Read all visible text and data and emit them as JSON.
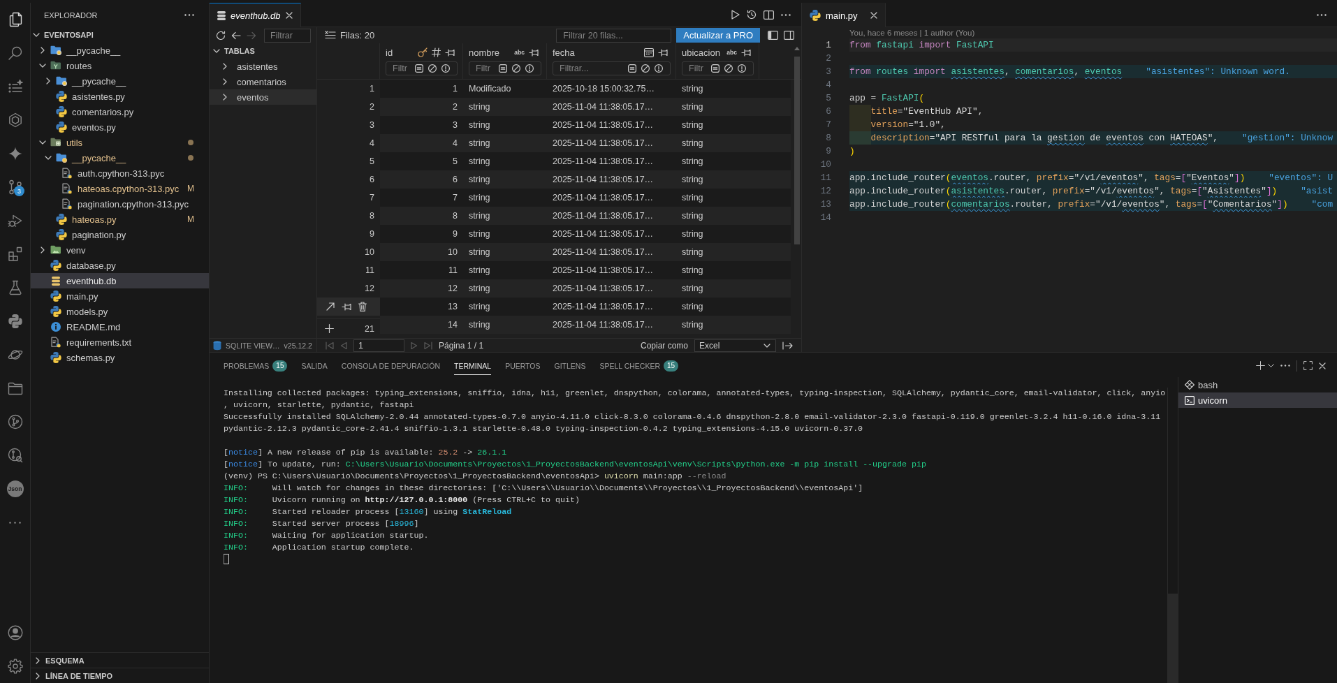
{
  "activity_bar": {
    "items": [
      {
        "kind": "explorer",
        "selected": true
      },
      {
        "kind": "search",
        "selected": false
      },
      {
        "kind": "tasks",
        "selected": false
      },
      {
        "kind": "hexagon",
        "selected": false
      },
      {
        "kind": "sparkle",
        "selected": false
      },
      {
        "kind": "source_control",
        "selected": false,
        "badge": "3"
      },
      {
        "kind": "debug",
        "selected": false
      },
      {
        "kind": "extensions",
        "selected": false
      },
      {
        "kind": "testing",
        "selected": false
      },
      {
        "kind": "python",
        "selected": false
      },
      {
        "kind": "orbit",
        "selected": false
      },
      {
        "kind": "projects",
        "selected": false
      },
      {
        "kind": "git_graph",
        "selected": false
      },
      {
        "kind": "git_inspect",
        "selected": false
      },
      {
        "kind": "json",
        "label": "Json",
        "selected": false
      },
      {
        "kind": "more",
        "selected": false
      }
    ],
    "bottom_items": [
      {
        "kind": "account",
        "selected": false
      },
      {
        "kind": "settings",
        "selected": false
      }
    ]
  },
  "explorer": {
    "title": "EXPLORADOR",
    "root": {
      "label": "EVENTOSAPI",
      "expanded": true
    },
    "tree": [
      {
        "label": "__pycache__",
        "kind": "cachefolder",
        "expanded": false,
        "modified": false,
        "selected": false
      },
      {
        "label": "routes",
        "kind": "routesfolder",
        "expanded": true,
        "modified": false,
        "selected": false,
        "children": [
          {
            "label": "__pycache__",
            "kind": "cachefolder",
            "expanded": false,
            "modified": false,
            "selected": false
          },
          {
            "label": "asistentes.py",
            "kind": "python",
            "modified": false,
            "selected": false
          },
          {
            "label": "comentarios.py",
            "kind": "python",
            "modified": false,
            "selected": false
          },
          {
            "label": "eventos.py",
            "kind": "python",
            "modified": false,
            "selected": false
          }
        ]
      },
      {
        "label": "utils",
        "kind": "utilsfolder",
        "expanded": true,
        "modified": true,
        "selected": false,
        "children": [
          {
            "label": "__pycache__",
            "kind": "cachefolder",
            "expanded": true,
            "modified": true,
            "selected": false,
            "children": [
              {
                "label": "auth.cpython-313.pyc",
                "kind": "bytecode",
                "modified": false,
                "selected": false
              },
              {
                "label": "hateoas.cpython-313.pyc",
                "kind": "bytecode",
                "modified": true,
                "decoration": "M",
                "selected": false
              },
              {
                "label": "pagination.cpython-313.pyc",
                "kind": "bytecode",
                "modified": false,
                "selected": false
              }
            ]
          },
          {
            "label": "hateoas.py",
            "kind": "python",
            "modified": true,
            "decoration": "M",
            "selected": false
          },
          {
            "label": "pagination.py",
            "kind": "python",
            "modified": false,
            "selected": false
          }
        ]
      },
      {
        "label": "venv",
        "kind": "envfolder",
        "expanded": false,
        "modified": false,
        "selected": false
      },
      {
        "label": "database.py",
        "kind": "python",
        "modified": false,
        "selected": false
      },
      {
        "label": "eventhub.db",
        "kind": "database",
        "modified": false,
        "selected": true
      },
      {
        "label": "main.py",
        "kind": "python",
        "modified": false,
        "selected": false
      },
      {
        "label": "models.py",
        "kind": "python",
        "modified": false,
        "selected": false
      },
      {
        "label": "README.md",
        "kind": "readme",
        "modified": false,
        "selected": false
      },
      {
        "label": "requirements.txt",
        "kind": "text",
        "modified": false,
        "selected": false
      },
      {
        "label": "schemas.py",
        "kind": "python",
        "modified": false,
        "selected": false
      }
    ],
    "sections": [
      {
        "label": "ESQUEMA",
        "expanded": false
      },
      {
        "label": "LÍNEA DE TIEMPO",
        "expanded": false
      }
    ]
  },
  "sqlite_editor": {
    "focused": true,
    "tab": {
      "label": "eventhub.db",
      "selected": true,
      "preview": true
    },
    "toolbar": {
      "navigation": [
        {
          "kind": "back",
          "disabled": false
        },
        {
          "kind": "forward",
          "disabled": true
        }
      ],
      "filter": {
        "placeholder": "Filtrar"
      },
      "row_count": "Filas: 20",
      "rows_filter": {
        "placeholder": "Filtrar 20 filas..."
      },
      "upgrade_button": "Actualizar a PRO"
    },
    "tables": {
      "title": "TABLAS",
      "expanded": true,
      "items": [
        {
          "label": "asistentes",
          "expanded": false,
          "selected": false
        },
        {
          "label": "comentarios",
          "expanded": false,
          "selected": false
        },
        {
          "label": "eventos",
          "expanded": false,
          "selected": true
        }
      ]
    },
    "grid": {
      "columns": [
        {
          "name": "id",
          "kind": "integer",
          "primary_key": true,
          "filter": {
            "placeholder": "Filtr"
          }
        },
        {
          "name": "nombre",
          "kind": "text",
          "type_label": "abc",
          "primary_key": false,
          "filter": {
            "placeholder": "Filtr"
          }
        },
        {
          "name": "fecha",
          "kind": "datetime",
          "primary_key": false,
          "filter": {
            "placeholder": "Filtrar..."
          }
        },
        {
          "name": "ubicacion",
          "kind": "text",
          "type_label": "abc",
          "primary_key": false,
          "filter": {
            "placeholder": "Filtr"
          }
        }
      ],
      "rows": [
        {
          "number": "1",
          "hovered": false,
          "cells": [
            "1",
            "Modificado",
            "2025-10-18 15:00:32.75…",
            "string"
          ]
        },
        {
          "number": "2",
          "hovered": false,
          "cells": [
            "2",
            "string",
            "2025-11-04 11:38:05.17…",
            "string"
          ]
        },
        {
          "number": "3",
          "hovered": false,
          "cells": [
            "3",
            "string",
            "2025-11-04 11:38:05.17…",
            "string"
          ]
        },
        {
          "number": "4",
          "hovered": false,
          "cells": [
            "4",
            "string",
            "2025-11-04 11:38:05.17…",
            "string"
          ]
        },
        {
          "number": "5",
          "hovered": false,
          "cells": [
            "5",
            "string",
            "2025-11-04 11:38:05.17…",
            "string"
          ]
        },
        {
          "number": "6",
          "hovered": false,
          "cells": [
            "6",
            "string",
            "2025-11-04 11:38:05.17…",
            "string"
          ]
        },
        {
          "number": "7",
          "hovered": false,
          "cells": [
            "7",
            "string",
            "2025-11-04 11:38:05.17…",
            "string"
          ]
        },
        {
          "number": "8",
          "hovered": false,
          "cells": [
            "8",
            "string",
            "2025-11-04 11:38:05.17…",
            "string"
          ]
        },
        {
          "number": "9",
          "hovered": false,
          "cells": [
            "9",
            "string",
            "2025-11-04 11:38:05.17…",
            "string"
          ]
        },
        {
          "number": "10",
          "hovered": false,
          "cells": [
            "10",
            "string",
            "2025-11-04 11:38:05.17…",
            "string"
          ]
        },
        {
          "number": "11",
          "hovered": false,
          "cells": [
            "11",
            "string",
            "2025-11-04 11:38:05.17…",
            "string"
          ]
        },
        {
          "number": "12",
          "hovered": false,
          "cells": [
            "12",
            "string",
            "2025-11-04 11:38:05.17…",
            "string"
          ]
        },
        {
          "hovered": true,
          "cells": [
            "13",
            "string",
            "2025-11-04 11:38:05.17…",
            "string"
          ]
        },
        {
          "hovered": false,
          "cells": [
            "14",
            "string",
            "2025-11-04 11:38:05.17…",
            "string"
          ]
        }
      ],
      "new_row_number": "21"
    },
    "footer": {
      "extension_name": "SQLITE VIEW…",
      "version": "v25.12.2",
      "pager": [
        {
          "kind": "first",
          "disabled": true
        },
        {
          "kind": "previous",
          "disabled": true
        },
        {
          "kind": "next",
          "disabled": true
        },
        {
          "kind": "last",
          "disabled": true
        }
      ],
      "page": {
        "value": "1"
      },
      "page_label": "Página 1 / 1",
      "copy_label": "Copiar como",
      "copy_format": {
        "value": "Excel"
      }
    }
  },
  "code_editor": {
    "focused": false,
    "tab": {
      "label": "main.py",
      "selected": true,
      "preview": false
    },
    "blame": "You, hace 6 meses | 1 author (You)",
    "lines": [
      {
        "number": "1",
        "current": true,
        "tokens": [
          {
            "text": "from ",
            "kind": "keyword"
          },
          {
            "text": "fastapi ",
            "kind": "module"
          },
          {
            "text": "import ",
            "kind": "keyword"
          },
          {
            "text": "FastAPI",
            "kind": "class"
          }
        ]
      },
      {
        "number": "2",
        "current": false
      },
      {
        "number": "3",
        "current": false,
        "tokens": [
          {
            "text": "from ",
            "kind": "keyword"
          },
          {
            "text": "routes ",
            "kind": "module"
          },
          {
            "text": "import ",
            "kind": "keyword"
          },
          {
            "text": "asistentes",
            "kind": "module",
            "squiggle": true
          },
          {
            "text": ", ",
            "kind": "plain"
          },
          {
            "text": "comentarios",
            "kind": "module",
            "squiggle": true
          },
          {
            "text": ", ",
            "kind": "plain"
          },
          {
            "text": "eventos",
            "kind": "module",
            "squiggle": true
          }
        ],
        "diagnostic": "\"asistentes\": Unknown word."
      },
      {
        "number": "4",
        "current": false
      },
      {
        "number": "5",
        "current": false,
        "tokens": [
          {
            "text": "app = ",
            "kind": "plain"
          },
          {
            "text": "FastAPI",
            "kind": "class"
          },
          {
            "text": "(",
            "kind": "bracket1"
          }
        ]
      },
      {
        "number": "6",
        "current": false,
        "indented": true,
        "tokens": [
          {
            "text": "title",
            "kind": "param"
          },
          {
            "text": "=",
            "kind": "plain"
          },
          {
            "text": "\"EventHub API\"",
            "kind": "string"
          },
          {
            "text": ",",
            "kind": "plain"
          }
        ]
      },
      {
        "number": "7",
        "current": false,
        "indented": true,
        "tokens": [
          {
            "text": "version",
            "kind": "param"
          },
          {
            "text": "=",
            "kind": "plain"
          },
          {
            "text": "\"1.0\"",
            "kind": "string"
          },
          {
            "text": ",",
            "kind": "plain"
          }
        ]
      },
      {
        "number": "8",
        "current": false,
        "indented": true,
        "tokens": [
          {
            "text": "description",
            "kind": "param"
          },
          {
            "text": "=",
            "kind": "plain"
          },
          {
            "text": "\"API RESTful para la ",
            "kind": "string"
          },
          {
            "text": "gestion",
            "kind": "string",
            "squiggle": true
          },
          {
            "text": " de ",
            "kind": "string"
          },
          {
            "text": "eventos",
            "kind": "string",
            "squiggle": true
          },
          {
            "text": " con ",
            "kind": "string"
          },
          {
            "text": "HATEOAS",
            "kind": "string",
            "squiggle": true
          },
          {
            "text": "\"",
            "kind": "string"
          },
          {
            "text": ",",
            "kind": "plain"
          }
        ],
        "diagnostic": "\"gestion\": Unknow"
      },
      {
        "number": "9",
        "current": false,
        "tokens": [
          {
            "text": ")",
            "kind": "bracket1"
          }
        ]
      },
      {
        "number": "10",
        "current": false
      },
      {
        "number": "11",
        "current": false,
        "tokens": [
          {
            "text": "app.include_router",
            "kind": "plain"
          },
          {
            "text": "(",
            "kind": "bracket1"
          },
          {
            "text": "eventos",
            "kind": "module",
            "squiggle": true
          },
          {
            "text": ".router, ",
            "kind": "plain"
          },
          {
            "text": "prefix",
            "kind": "param"
          },
          {
            "text": "=",
            "kind": "plain"
          },
          {
            "text": "\"/v1/",
            "kind": "string"
          },
          {
            "text": "eventos",
            "kind": "string",
            "squiggle": true
          },
          {
            "text": "\"",
            "kind": "string"
          },
          {
            "text": ", ",
            "kind": "plain"
          },
          {
            "text": "tags",
            "kind": "param"
          },
          {
            "text": "=",
            "kind": "plain"
          },
          {
            "text": "[",
            "kind": "bracket2"
          },
          {
            "text": "\"",
            "kind": "string"
          },
          {
            "text": "Eventos",
            "kind": "string",
            "squiggle": true
          },
          {
            "text": "\"",
            "kind": "string"
          },
          {
            "text": "]",
            "kind": "bracket2"
          },
          {
            "text": ")",
            "kind": "bracket1"
          }
        ],
        "diagnostic": "\"eventos\": U"
      },
      {
        "number": "12",
        "current": false,
        "tokens": [
          {
            "text": "app.include_router",
            "kind": "plain"
          },
          {
            "text": "(",
            "kind": "bracket1"
          },
          {
            "text": "asistentes",
            "kind": "module",
            "squiggle": true
          },
          {
            "text": ".router, ",
            "kind": "plain"
          },
          {
            "text": "prefix",
            "kind": "param"
          },
          {
            "text": "=",
            "kind": "plain"
          },
          {
            "text": "\"/v1/",
            "kind": "string"
          },
          {
            "text": "eventos",
            "kind": "string",
            "squiggle": true
          },
          {
            "text": "\"",
            "kind": "string"
          },
          {
            "text": ", ",
            "kind": "plain"
          },
          {
            "text": "tags",
            "kind": "param"
          },
          {
            "text": "=",
            "kind": "plain"
          },
          {
            "text": "[",
            "kind": "bracket2"
          },
          {
            "text": "\"",
            "kind": "string"
          },
          {
            "text": "Asistentes",
            "kind": "string",
            "squiggle": true
          },
          {
            "text": "\"",
            "kind": "string"
          },
          {
            "text": "]",
            "kind": "bracket2"
          },
          {
            "text": ")",
            "kind": "bracket1"
          }
        ],
        "diagnostic": "\"asist"
      },
      {
        "number": "13",
        "current": false,
        "tokens": [
          {
            "text": "app.include_router",
            "kind": "plain"
          },
          {
            "text": "(",
            "kind": "bracket1"
          },
          {
            "text": "comentarios",
            "kind": "module",
            "squiggle": true
          },
          {
            "text": ".router, ",
            "kind": "plain"
          },
          {
            "text": "prefix",
            "kind": "param"
          },
          {
            "text": "=",
            "kind": "plain"
          },
          {
            "text": "\"/v1/",
            "kind": "string"
          },
          {
            "text": "eventos",
            "kind": "string",
            "squiggle": true
          },
          {
            "text": "\"",
            "kind": "string"
          },
          {
            "text": ", ",
            "kind": "plain"
          },
          {
            "text": "tags",
            "kind": "param"
          },
          {
            "text": "=",
            "kind": "plain"
          },
          {
            "text": "[",
            "kind": "bracket2"
          },
          {
            "text": "\"",
            "kind": "string"
          },
          {
            "text": "Comentarios",
            "kind": "string",
            "squiggle": true
          },
          {
            "text": "\"",
            "kind": "string"
          },
          {
            "text": "]",
            "kind": "bracket2"
          },
          {
            "text": ")",
            "kind": "bracket1"
          }
        ],
        "diagnostic": "\"com"
      },
      {
        "number": "14",
        "current": false
      }
    ]
  },
  "panel": {
    "tabs": [
      {
        "label": "PROBLEMAS",
        "badge": "15",
        "selected": false
      },
      {
        "label": "SALIDA",
        "selected": false
      },
      {
        "label": "CONSOLA DE DEPURACIÓN",
        "selected": false
      },
      {
        "label": "TERMINAL",
        "selected": true
      },
      {
        "label": "PUERTOS",
        "selected": false
      },
      {
        "label": "GITLENS",
        "selected": false
      },
      {
        "label": "SPELL CHECKER",
        "badge": "15",
        "selected": false
      }
    ],
    "terminal": {
      "lines": [
        {
          "spans": [
            {
              "text": "Installing collected packages: typing_extensions, sniffio, idna, h11, greenlet, dnspython, colorama, annotated-types, typing-inspection, SQLAlchemy, pydantic_core, email-validator, click, anyio",
              "kind": "plain"
            }
          ]
        },
        {
          "spans": [
            {
              "text": ", uvicorn, starlette, pydantic, fastapi",
              "kind": "plain"
            }
          ]
        },
        {
          "spans": [
            {
              "text": "Successfully installed SQLAlchemy-2.0.44 annotated-types-0.7.0 anyio-4.11.0 click-8.3.0 colorama-0.4.6 dnspython-2.8.0 email-validator-2.3.0 fastapi-0.119.0 greenlet-3.2.4 h11-0.16.0 idna-3.11",
              "kind": "plain"
            }
          ]
        },
        {
          "spans": [
            {
              "text": "pydantic-2.12.3 pydantic_core-2.41.4 sniffio-1.3.1 starlette-0.48.0 typing-inspection-0.4.2 typing_extensions-4.15.0 uvicorn-0.37.0",
              "kind": "plain"
            }
          ]
        },
        {
          "blank_before": true,
          "spans": [
            {
              "text": "[",
              "kind": "plain"
            },
            {
              "text": "notice",
              "kind": "notice"
            },
            {
              "text": "] A new release of pip is available: ",
              "kind": "plain"
            },
            {
              "text": "25.2",
              "kind": "old"
            },
            {
              "text": " -> ",
              "kind": "plain"
            },
            {
              "text": "26.1.1",
              "kind": "new"
            }
          ]
        },
        {
          "spans": [
            {
              "text": "[",
              "kind": "plain"
            },
            {
              "text": "notice",
              "kind": "notice"
            },
            {
              "text": "] To update, run: ",
              "kind": "plain"
            },
            {
              "text": "C:\\Users\\Usuario\\Documents\\Proyectos\\1_ProyectosBackend\\eventosApi\\venv\\Scripts\\python.exe -m pip install --upgrade pip",
              "kind": "command"
            }
          ]
        },
        {
          "spans": [
            {
              "text": "(venv) PS C:\\Users\\Usuario\\Documents\\Proyectos\\1_ProyectosBackend\\eventosApi> ",
              "kind": "plain"
            },
            {
              "text": "uvicorn",
              "kind": "program"
            },
            {
              "text": " main:app ",
              "kind": "plain"
            },
            {
              "text": "--reload",
              "kind": "flag"
            }
          ]
        },
        {
          "spans": [
            {
              "text": "INFO:",
              "kind": "info"
            },
            {
              "text": "     Will watch for changes in these directories: ['C:\\\\Users\\\\Usuario\\\\Documents\\\\Proyectos\\\\1_ProyectosBackend\\\\eventosApi']",
              "kind": "plain"
            }
          ]
        },
        {
          "spans": [
            {
              "text": "INFO:",
              "kind": "info"
            },
            {
              "text": "     Uvicorn running on ",
              "kind": "plain"
            },
            {
              "text": "http://127.0.0.1:8000",
              "kind": "link"
            },
            {
              "text": " (Press CTRL+C to quit)",
              "kind": "plain"
            }
          ]
        },
        {
          "spans": [
            {
              "text": "INFO:",
              "kind": "info"
            },
            {
              "text": "     Started reloader process [",
              "kind": "plain"
            },
            {
              "text": "13160",
              "kind": "number"
            },
            {
              "text": "] using ",
              "kind": "plain"
            },
            {
              "text": "StatReload",
              "kind": "name"
            }
          ]
        },
        {
          "spans": [
            {
              "text": "INFO:",
              "kind": "info"
            },
            {
              "text": "     Started server process [",
              "kind": "plain"
            },
            {
              "text": "18996",
              "kind": "number"
            },
            {
              "text": "]",
              "kind": "plain"
            }
          ]
        },
        {
          "spans": [
            {
              "text": "INFO:",
              "kind": "info"
            },
            {
              "text": "     Waiting for application startup.",
              "kind": "plain"
            }
          ]
        },
        {
          "spans": [
            {
              "text": "INFO:",
              "kind": "info"
            },
            {
              "text": "     Application startup complete.",
              "kind": "plain"
            }
          ]
        }
      ],
      "cursor": true
    },
    "sessions": [
      {
        "label": "bash",
        "kind": "bash",
        "selected": false
      },
      {
        "label": "uvicorn",
        "kind": "shell",
        "selected": true
      }
    ]
  }
}
